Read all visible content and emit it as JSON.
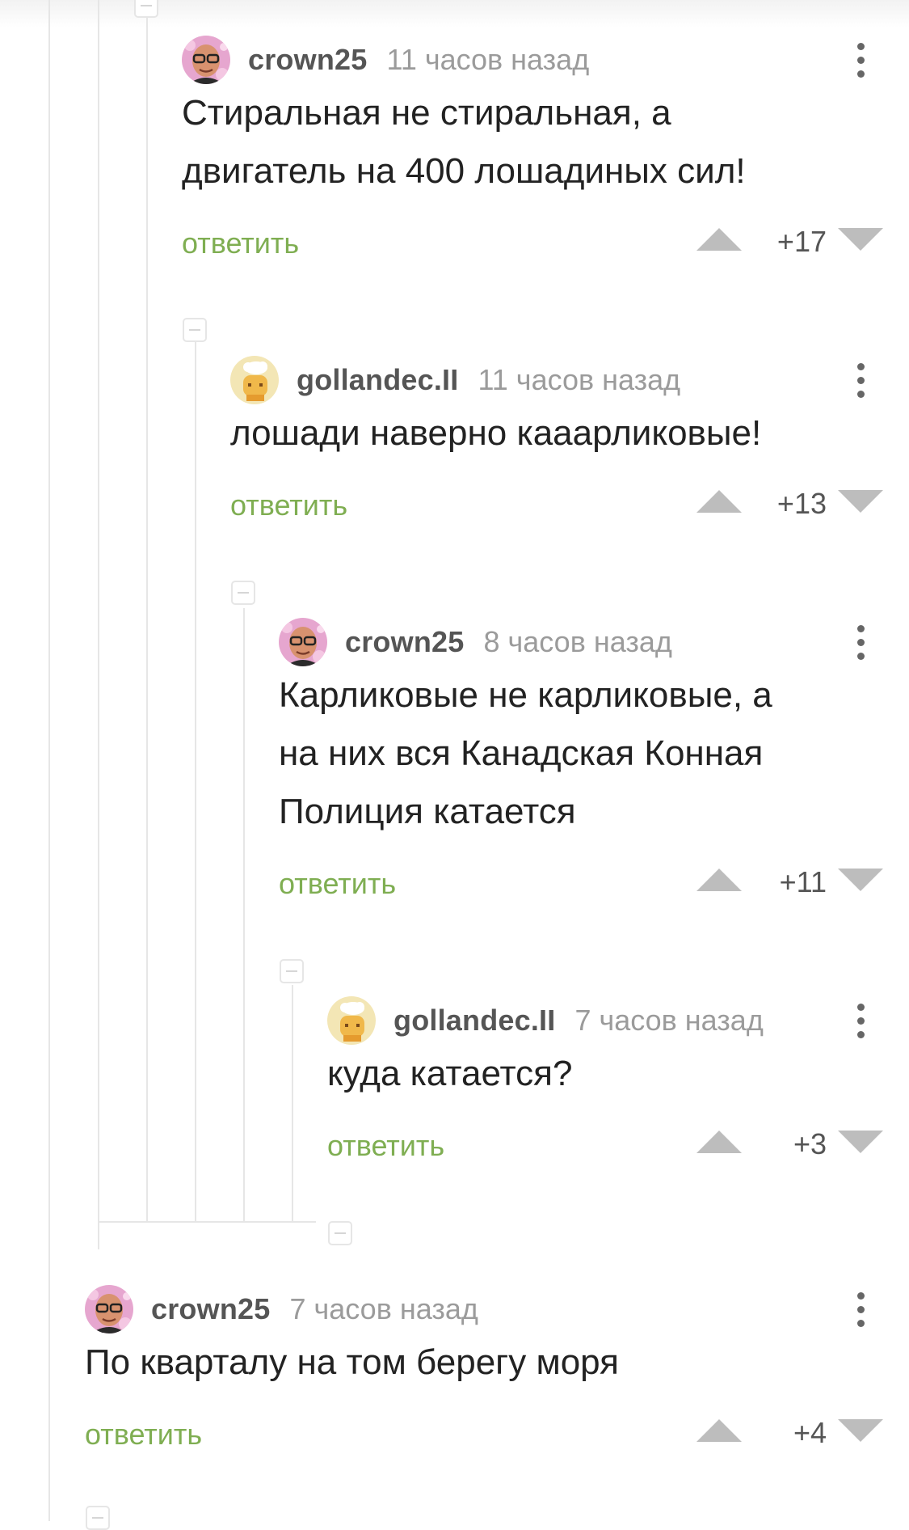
{
  "comments": [
    {
      "username": "crown25",
      "time": "11 часов назад",
      "lines": [
        "Стиральная не стиральная, а",
        "двигатель на 400 лошадиных сил!"
      ],
      "reply": "ответить",
      "score": "+17",
      "avatar": "bald-man-glasses"
    },
    {
      "username": "gollandec.II",
      "time": "11 часов назад",
      "lines": [
        "лошади наверно кааарликовые!"
      ],
      "reply": "ответить",
      "score": "+13",
      "avatar": "yellow-chef-character"
    },
    {
      "username": "crown25",
      "time": "8 часов назад",
      "lines": [
        "Карликовые не карликовые, а",
        "на них вся Канадская Конная",
        "Полиция катается"
      ],
      "reply": "ответить",
      "score": "+11",
      "avatar": "bald-man-glasses"
    },
    {
      "username": "gollandec.II",
      "time": "7 часов назад",
      "lines": [
        "куда катается?"
      ],
      "reply": "ответить",
      "score": "+3",
      "avatar": "yellow-chef-character"
    },
    {
      "username": "crown25",
      "time": "7 часов назад",
      "lines": [
        "По кварталу на том берегу моря"
      ],
      "reply": "ответить",
      "score": "+4",
      "avatar": "bald-man-glasses"
    }
  ],
  "colors": {
    "reply": "#7fae52",
    "thread_line": "#e6e6e6",
    "vote_arrow": "#bdbdbd"
  }
}
